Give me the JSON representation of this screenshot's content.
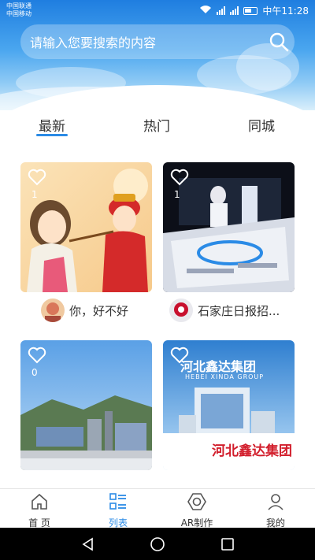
{
  "status": {
    "carrier1": "中国联通",
    "carrier2": "中国移动",
    "time": "中午11:28"
  },
  "search": {
    "placeholder": "请输入您要搜索的内容"
  },
  "tabs": [
    {
      "label": "最新",
      "active": true
    },
    {
      "label": "热门",
      "active": false
    },
    {
      "label": "同城",
      "active": false
    }
  ],
  "cards": [
    {
      "likes": "1",
      "author": "你，好不好"
    },
    {
      "likes": "1",
      "author": "石家庄日报招..."
    },
    {
      "likes": "0",
      "author": ""
    },
    {
      "likes": "",
      "author": "",
      "image_text_title": "河北鑫达集团",
      "image_text_sub": "HEBEI XINDA GROUP",
      "image_text_banner": "河北鑫达集团"
    }
  ],
  "bottom_nav": [
    {
      "label": "首 页",
      "icon": "home-icon"
    },
    {
      "label": "列表",
      "icon": "list-icon",
      "active": true
    },
    {
      "label": "AR制作",
      "icon": "ar-camera-icon"
    },
    {
      "label": "我的",
      "icon": "user-icon"
    }
  ],
  "colors": {
    "accent": "#2b8be6",
    "header": "#1f7ee0"
  }
}
